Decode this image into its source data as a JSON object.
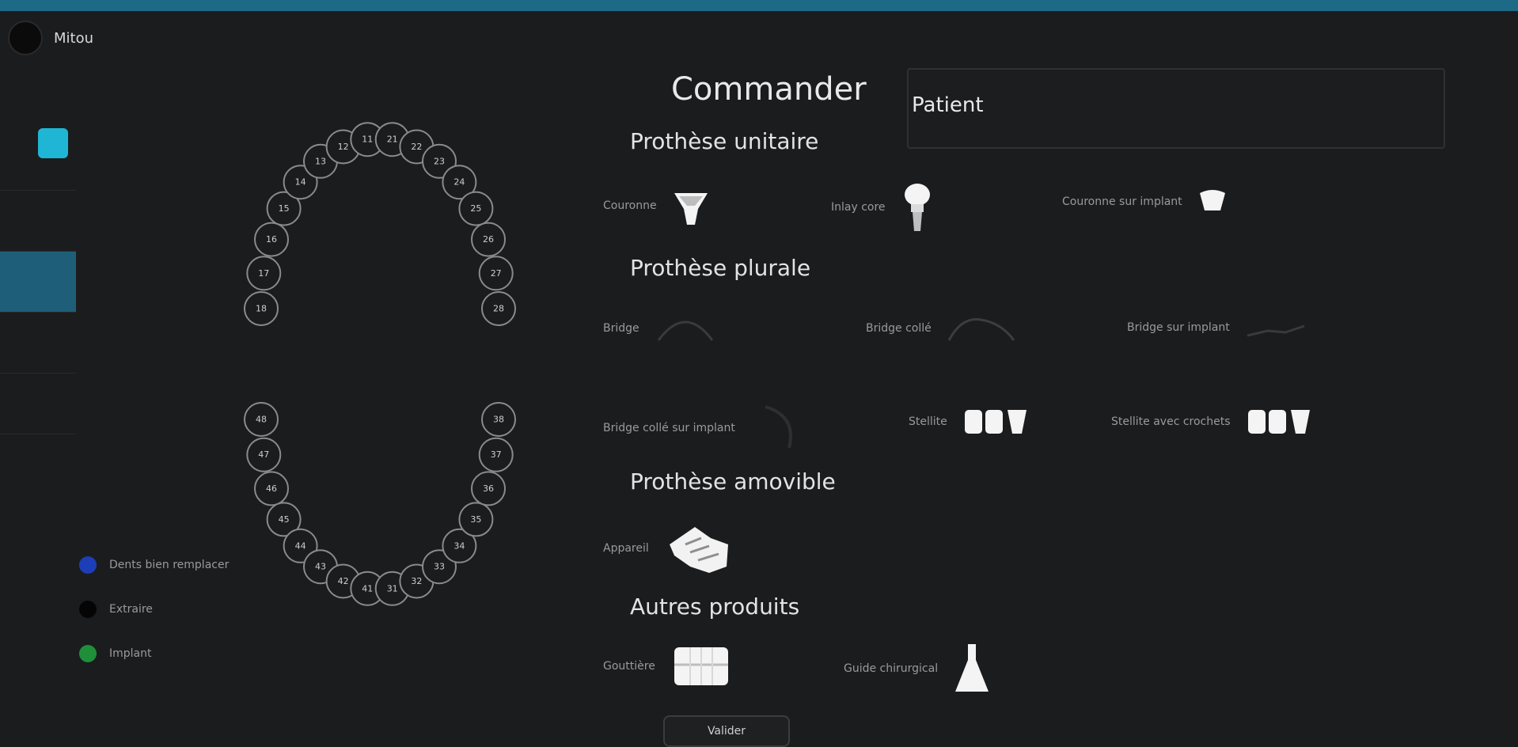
{
  "app": {
    "name": "Mitou"
  },
  "colors": {
    "accent": "#1d6a86",
    "chip": "#1fb6d5"
  },
  "legend": [
    {
      "color": "#1c3fb8",
      "label": "Dents bien remplacer"
    },
    {
      "color": "#050505",
      "label": "Extraire"
    },
    {
      "color": "#1f8f3a",
      "label": "Implant"
    }
  ],
  "teeth": {
    "upper": [
      "18",
      "17",
      "16",
      "15",
      "14",
      "13",
      "12",
      "11",
      "21",
      "22",
      "23",
      "24",
      "25",
      "26",
      "27",
      "28"
    ],
    "lower": [
      "48",
      "47",
      "46",
      "45",
      "44",
      "43",
      "42",
      "41",
      "31",
      "32",
      "33",
      "34",
      "35",
      "36",
      "37",
      "38"
    ]
  },
  "main": {
    "title": "Commander",
    "patient_value": "Patient",
    "sections": {
      "unitaire": "Prothèse unitaire",
      "plurale": "Prothèse plurale",
      "amovible": "Prothèse amovible",
      "autres": "Autres produits"
    },
    "unitaire_items": [
      {
        "label": "Couronne",
        "icon": "crown-icon"
      },
      {
        "label": "Inlay core",
        "icon": "implant-tooth-icon"
      },
      {
        "label": "Couronne sur implant",
        "icon": "small-crown-icon"
      }
    ],
    "plurale_items": [
      {
        "label": "Bridge",
        "icon": "bridge-arc-icon"
      },
      {
        "label": "Bridge collé",
        "icon": "bridge-wave-icon"
      },
      {
        "label": "Bridge sur implant",
        "icon": "bridge-flat-icon"
      },
      {
        "label": "Bridge collé sur implant",
        "icon": "bridge-curve-icon"
      },
      {
        "label": "Stellite",
        "icon": "multi-tooth-icon"
      },
      {
        "label": "Stellite avec crochets",
        "icon": "multi-tooth-icon"
      }
    ],
    "amovible_items": [
      {
        "label": "Appareil",
        "icon": "hand-icon"
      }
    ],
    "autres_items": [
      {
        "label": "Gouttière",
        "icon": "aligner-icon"
      },
      {
        "label": "Guide chirurgical",
        "icon": "flask-icon"
      }
    ],
    "bottom_button": "Valider"
  }
}
